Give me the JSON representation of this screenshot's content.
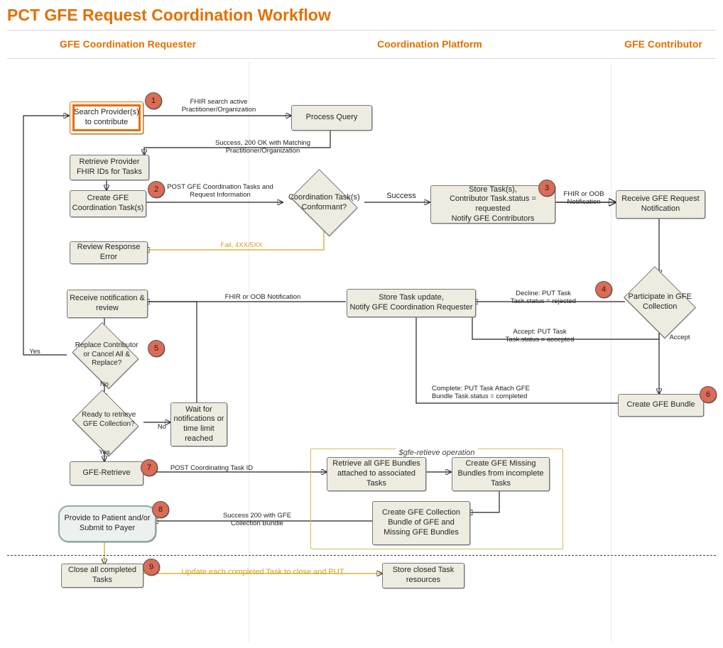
{
  "title": "PCT GFE Request Coordination Workflow",
  "lanes": {
    "requester": "GFE Coordination Requester",
    "platform": "Coordination Platform",
    "contributor": "GFE Contributor"
  },
  "nodes": {
    "search_providers": "Search Provider(s) to contribute",
    "process_query": "Process Query",
    "retrieve_ids": "Retrieve Provider FHIR IDs for Tasks",
    "create_tasks": "Create GFE Coordination Task(s)",
    "conformant": "Coordination Task(s) Conformant?",
    "store_tasks": "Store Task(s),\nContributor Task.status = requested\nNotify GFE Contributors",
    "receive_request": "Receive GFE Request Notification",
    "review_error": "Review Response Error",
    "participate": "Participate in GFE Collection",
    "store_update": "Store Task update,\nNotify GFE Coordination Requester",
    "receive_review": "Receive notification & review",
    "replace": "Replace Contributor or Cancel All & Replace?",
    "ready_retrieve": "Ready to retrieve GFE Collection?",
    "wait_notify": "Wait for notifications or time limit reached",
    "create_bundle": "Create GFE Bundle",
    "gfe_retrieve": "GFE-Retrieve",
    "retrieve_bundles": "Retrieve all GFE Bundles attached to associated Tasks",
    "missing_bundles": "Create GFE Missing Bundles from incomplete Tasks",
    "collection_bundle": "Create GFE Collection Bundle of GFE and Missing GFE Bundles",
    "provide_patient": "Provide to Patient and/or Submit to Payer",
    "close_tasks": "Close all completed Tasks",
    "store_closed": "Store closed Task resources"
  },
  "group": {
    "gfe_retrieve_op": "$gfe-retieve operation"
  },
  "edges": {
    "fhir_search": "FHIR search active\nPractitioner/Organization",
    "success_200": "Success, 200 OK with\nMatching Practitioner/Organization",
    "post_tasks": "POST GFE Coordination Tasks\nand Request Information",
    "success": "Success",
    "fail_4xx": "Fail, 4XX/5XX",
    "fhir_oob_notif": "FHIR or OOB\nNotification",
    "fhir_oob_notif2": "FHIR or OOB Notification",
    "decline": "Decline: PUT Task\nTask.status = rejected",
    "accept_put": "Accept: PUT Task\nTask.status = accepted",
    "accept": "Accept",
    "complete": "Complete: PUT Task\nAttach GFE Bundle\nTask.status = completed",
    "yes": "Yes",
    "no": "No",
    "post_coord": "POST Coordinating Task ID",
    "success_collection": "Success 200 with\nGFE Collection Bundle",
    "update_close": "Update each completed Task to close and PUT"
  },
  "badges": [
    "1",
    "2",
    "3",
    "4",
    "5",
    "6",
    "7",
    "8",
    "9"
  ]
}
